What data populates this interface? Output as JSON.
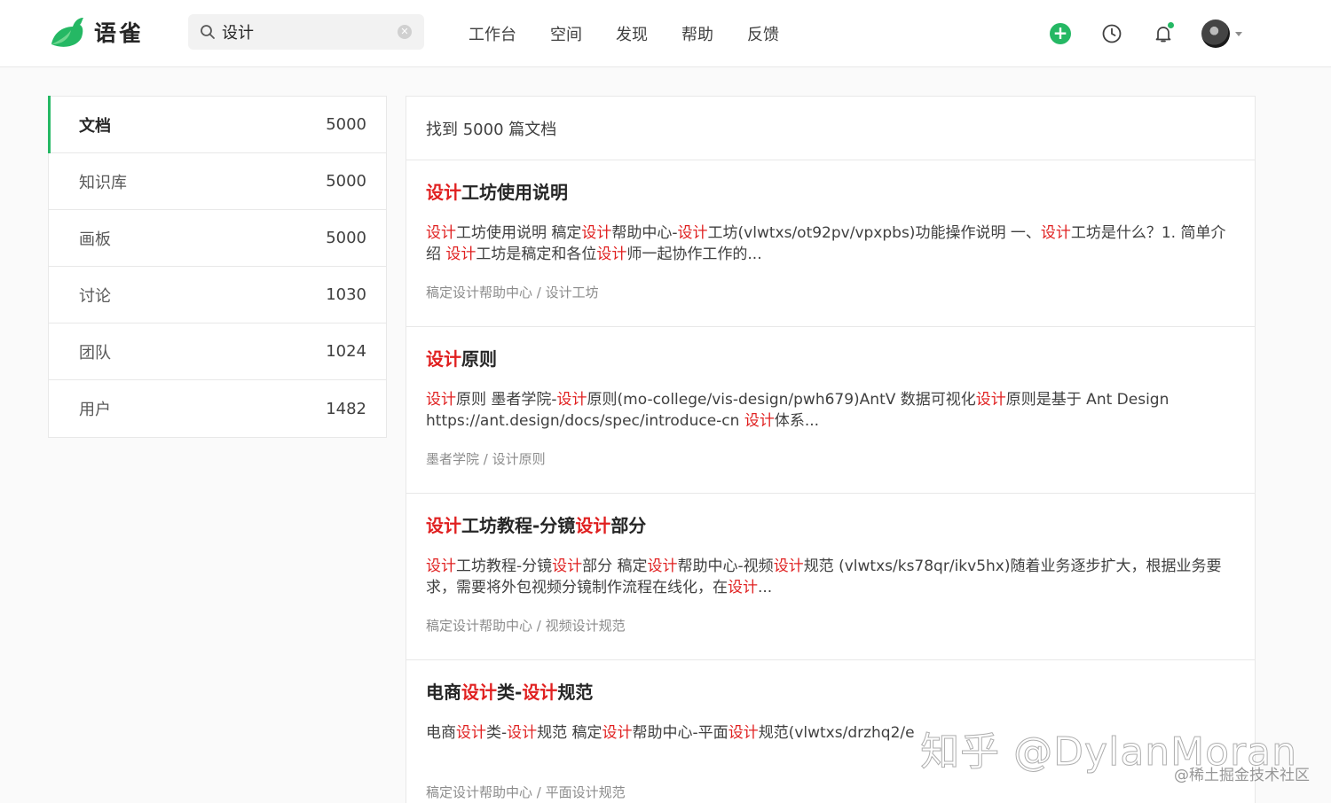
{
  "brand": {
    "name": "语雀",
    "accent": "#25b864"
  },
  "search": {
    "value": "设计"
  },
  "nav": [
    "工作台",
    "空间",
    "发现",
    "帮助",
    "反馈"
  ],
  "sidebar": [
    {
      "label": "文档",
      "count": "5000",
      "active": true
    },
    {
      "label": "知识库",
      "count": "5000"
    },
    {
      "label": "画板",
      "count": "5000"
    },
    {
      "label": "讨论",
      "count": "1030"
    },
    {
      "label": "团队",
      "count": "1024"
    },
    {
      "label": "用户",
      "count": "1482"
    }
  ],
  "results_summary": "找到 5000 篇文档",
  "highlight_color": "#e02020",
  "results": [
    {
      "title": [
        [
          "设计",
          true
        ],
        [
          "工坊使用说明",
          false
        ]
      ],
      "snippet": [
        [
          "设计",
          true
        ],
        [
          "工坊使用说明 稿定",
          false
        ],
        [
          "设计",
          true
        ],
        [
          "帮助中心-",
          false
        ],
        [
          "设计",
          true
        ],
        [
          "工坊(vlwtxs/ot92pv/vpxpbs)功能操作说明 一、",
          false
        ],
        [
          "设计",
          true
        ],
        [
          "工坊是什么？1. 简单介绍 ",
          false
        ],
        [
          "设计",
          true
        ],
        [
          "工坊是稿定和各位",
          false
        ],
        [
          "设计",
          true
        ],
        [
          "师一起协作工作的...",
          false
        ]
      ],
      "path": "稿定设计帮助中心 / 设计工坊"
    },
    {
      "title": [
        [
          "设计",
          true
        ],
        [
          "原则",
          false
        ]
      ],
      "snippet": [
        [
          "设计",
          true
        ],
        [
          "原则 墨者学院-",
          false
        ],
        [
          "设计",
          true
        ],
        [
          "原则(mo-college/vis-design/pwh679)AntV 数据可视化",
          false
        ],
        [
          "设计",
          true
        ],
        [
          "原则是基于 Ant Design https://ant.design/docs/spec/introduce-cn  ",
          false
        ],
        [
          "设计",
          true
        ],
        [
          "体系...",
          false
        ]
      ],
      "path": "墨者学院 / 设计原则"
    },
    {
      "title": [
        [
          "设计",
          true
        ],
        [
          "工坊教程-分镜",
          false
        ],
        [
          "设计",
          true
        ],
        [
          "部分",
          false
        ]
      ],
      "snippet": [
        [
          "设计",
          true
        ],
        [
          "工坊教程-分镜",
          false
        ],
        [
          "设计",
          true
        ],
        [
          "部分 稿定",
          false
        ],
        [
          "设计",
          true
        ],
        [
          "帮助中心-视频",
          false
        ],
        [
          "设计",
          true
        ],
        [
          "规范 (vlwtxs/ks78qr/ikv5hx)随着业务逐步扩大，根据业务要求，需要将外包视频分镜制作流程在线化，在",
          false
        ],
        [
          "设计",
          true
        ],
        [
          "...",
          false
        ]
      ],
      "path": "稿定设计帮助中心 / 视频设计规范"
    },
    {
      "title": [
        [
          "电商",
          false
        ],
        [
          "设计",
          true
        ],
        [
          "类-",
          false
        ],
        [
          "设计",
          true
        ],
        [
          "规范",
          false
        ]
      ],
      "snippet": [
        [
          "电商",
          false
        ],
        [
          "设计",
          true
        ],
        [
          "类-",
          false
        ],
        [
          "设计",
          true
        ],
        [
          "规范 稿定",
          false
        ],
        [
          "设计",
          true
        ],
        [
          "帮助中心-平面",
          false
        ],
        [
          "设计",
          true
        ],
        [
          "规范(vlwtxs/drzhq2/e",
          false
        ]
      ],
      "path": "稿定设计帮助中心 / 平面设计规范"
    }
  ],
  "watermark": "知乎 @DylanMoran",
  "watermark_sub": "@稀土掘金技术社区"
}
